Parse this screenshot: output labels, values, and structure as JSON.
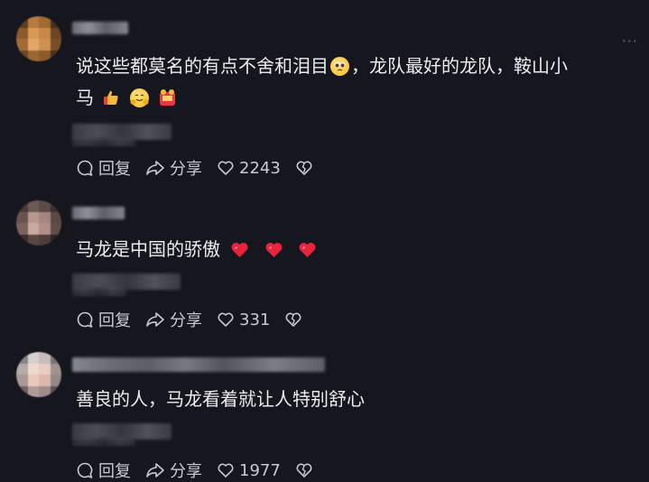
{
  "comments": [
    {
      "text_line1": "说这些都莫名的有点不舍和泪目",
      "text_line1_tail": "，龙队最好的龙队，鞍山小",
      "text_line2": "马",
      "emojis": [
        "pleading-face-icon",
        "thumbs-up-icon",
        "hugging-face-icon",
        "red-envelope-icon"
      ],
      "reply_label": "回复",
      "share_label": "分享",
      "like_count": "2243",
      "has_more_menu": true
    },
    {
      "text_line1": "马龙是中国的骄傲",
      "emojis": [
        "red-heart-icon",
        "red-heart-icon",
        "red-heart-icon"
      ],
      "reply_label": "回复",
      "share_label": "分享",
      "like_count": "331"
    },
    {
      "text_line1": "善良的人，马龙看着就让人特别舒心",
      "emojis": [],
      "reply_label": "回复",
      "share_label": "分享",
      "like_count": "1977"
    }
  ],
  "colors": {
    "background": "#15161e",
    "text": "#ececf1",
    "action_text": "#c9cad2",
    "heart": "#e8243c"
  },
  "more_menu_label": "···"
}
